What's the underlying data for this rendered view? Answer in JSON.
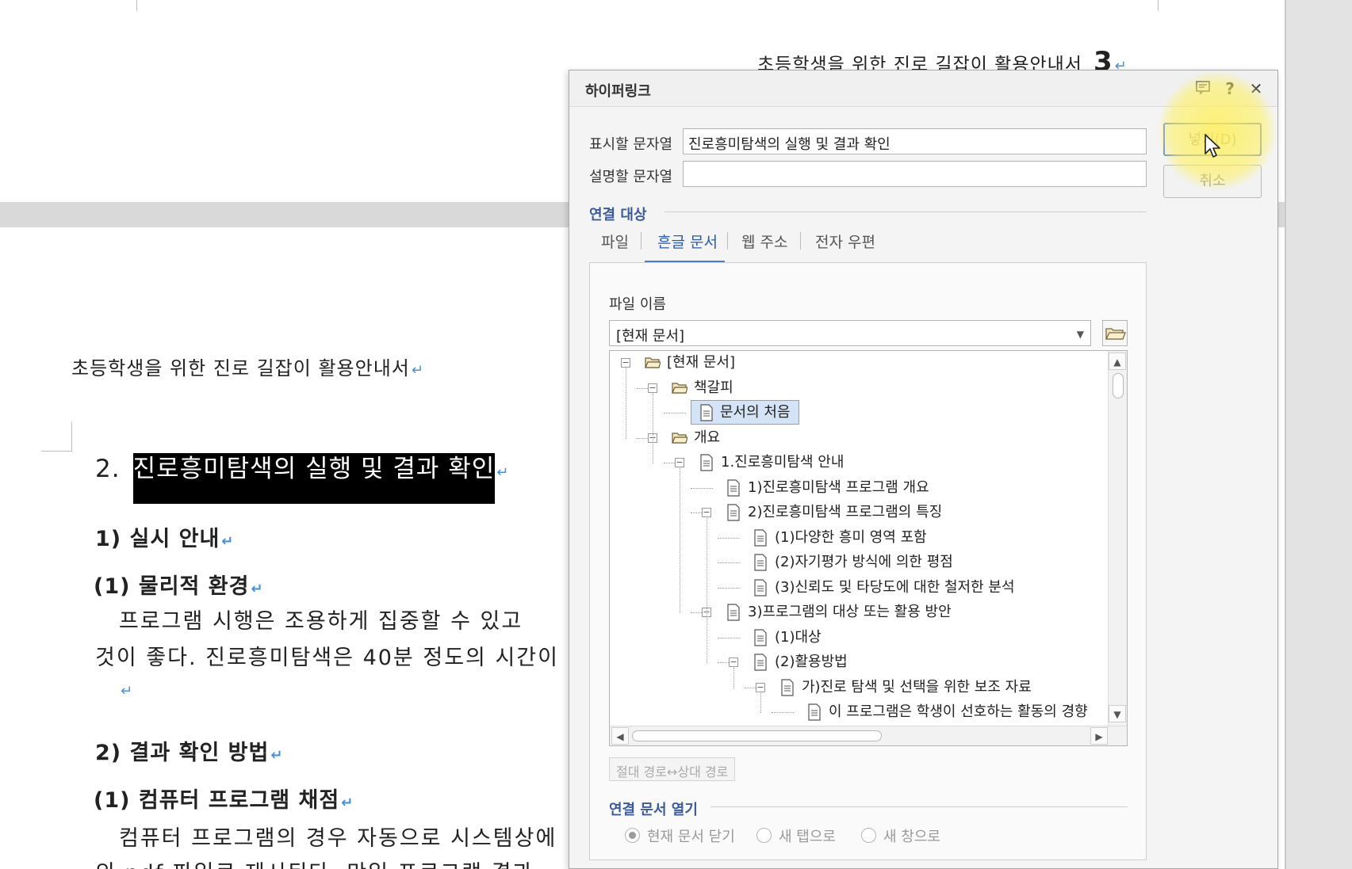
{
  "document": {
    "running_header_top": "초등학생을 위한 진로 길잡이 활용안내서",
    "page_number": "3",
    "running_header": "초등학생을 위한 진로 길잡이 활용안내서",
    "heading_number": "2.",
    "heading_title": "진로흥미탐색의 실행 및 결과 확인",
    "sub1": "1) 실시 안내",
    "sub1_1": "(1) 물리적 환경",
    "body1_line1": "프로그램 시행은 조용하게 집중할 수 있고",
    "body1_line2": "것이 좋다. 진로흥미탐색은 40분 정도의 시간이",
    "sub2": "2) 결과 확인 방법",
    "sub2_1": "(1) 컴퓨터 프로그램 채점",
    "body2_line1": "컴퓨터 프로그램의 경우 자동으로 시스템상에",
    "body2_line2": "의 pdf 파일로 제시된다. 만일 프로그램 결과",
    "para_mark": "↵"
  },
  "dialog": {
    "title": "하이퍼링크",
    "icons": {
      "help": "?",
      "close": "✕",
      "memo": "memo-icon"
    },
    "display_text_label": "표시할 문자열",
    "display_text_value": "진로흥미탐색의 실행 및 결과 확인",
    "description_label": "설명할 문자열",
    "description_value": "",
    "insert_button": "넣기(D)",
    "cancel_button": "취소",
    "link_target_section": "연결 대상",
    "tabs": [
      {
        "label": "파일",
        "active": false
      },
      {
        "label": "흔글 문서",
        "active": true
      },
      {
        "label": "웹 주소",
        "active": false
      },
      {
        "label": "전자 우편",
        "active": false
      }
    ],
    "file_name_label": "파일 이름",
    "file_name_value": "[현재 문서]",
    "tree": [
      {
        "label": "[현재 문서]",
        "level": 0,
        "kind": "folder",
        "expander": "−"
      },
      {
        "label": "책갈피",
        "level": 1,
        "kind": "folder",
        "expander": "−"
      },
      {
        "label": "문서의 처음",
        "level": 2,
        "kind": "doc",
        "selected": true
      },
      {
        "label": "개요",
        "level": 1,
        "kind": "folder",
        "expander": "−"
      },
      {
        "label": "1.진로흥미탐색 안내",
        "level": 2,
        "kind": "doc",
        "expander": "−"
      },
      {
        "label": "1)진로흥미탐색 프로그램 개요",
        "level": 3,
        "kind": "doc"
      },
      {
        "label": "2)진로흥미탐색 프로그램의 특징",
        "level": 3,
        "kind": "doc",
        "expander": "−"
      },
      {
        "label": "(1)다양한 흥미 영역 포함",
        "level": 4,
        "kind": "doc"
      },
      {
        "label": "(2)자기평가 방식에 의한 평점",
        "level": 4,
        "kind": "doc"
      },
      {
        "label": "(3)신뢰도 및 타당도에 대한 철저한 분석",
        "level": 4,
        "kind": "doc"
      },
      {
        "label": "3)프로그램의 대상 또는 활용 방안",
        "level": 3,
        "kind": "doc",
        "expander": "−"
      },
      {
        "label": "(1)대상",
        "level": 4,
        "kind": "doc"
      },
      {
        "label": "(2)활용방법",
        "level": 4,
        "kind": "doc",
        "expander": "−"
      },
      {
        "label": "가)진로 탐색 및 선택을 위한 보조 자료",
        "level": 5,
        "kind": "doc",
        "expander": "−"
      },
      {
        "label": "이 프로그램은 학생이 선호하는 활동의 경향",
        "level": 6,
        "kind": "doc"
      }
    ],
    "path_toggle_button": "절대 경로↔상대 경로",
    "open_section": "연결 문서 열기",
    "open_options": [
      {
        "label": "현재 문서 닫기",
        "checked": true
      },
      {
        "label": "새 탭으로",
        "checked": false
      },
      {
        "label": "새 창으로",
        "checked": false
      }
    ]
  }
}
